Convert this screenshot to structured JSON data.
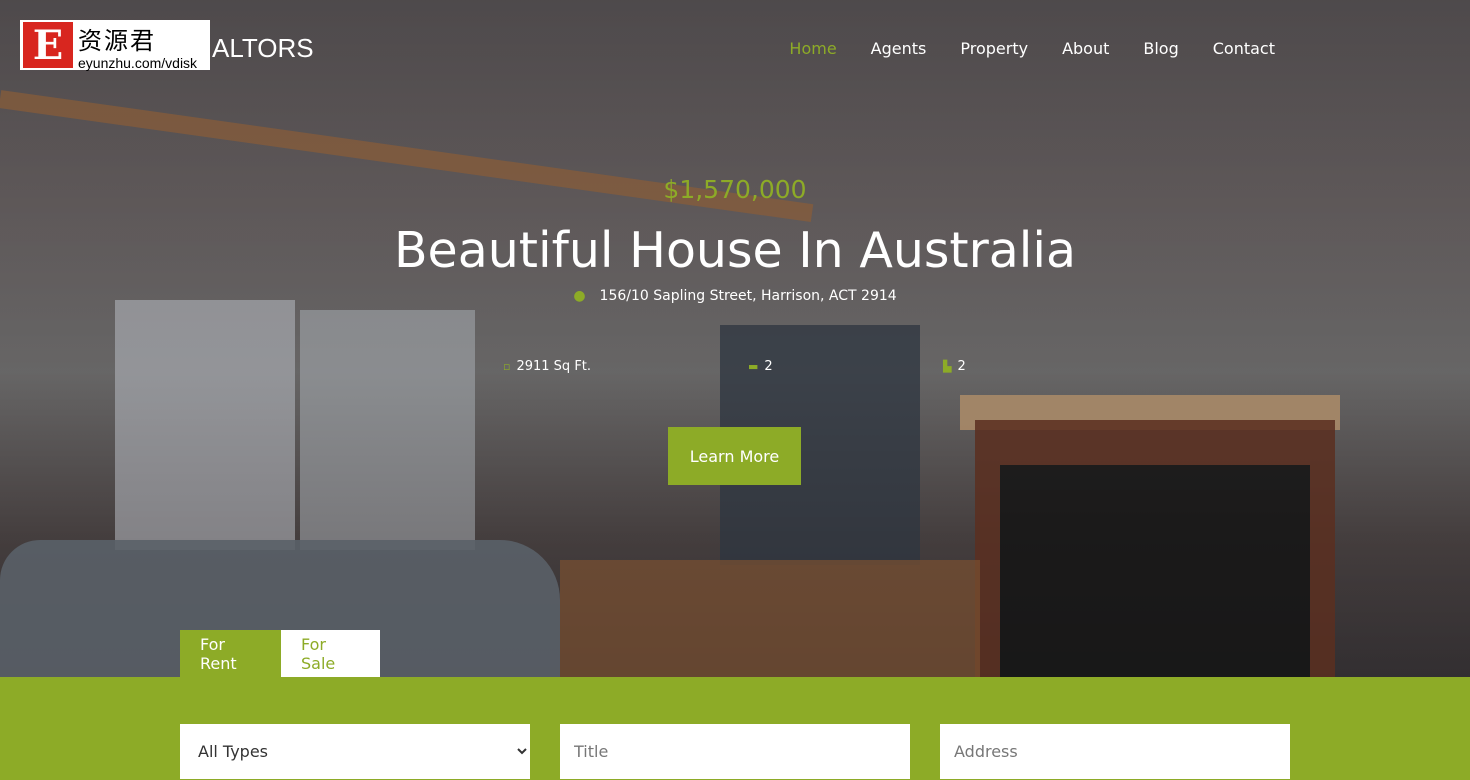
{
  "logo": {
    "letter": "E",
    "chinese": "资源君",
    "url": "eyunzhu.com/vdisk"
  },
  "brand": "ALTORS",
  "nav": [
    {
      "label": "Home",
      "active": true
    },
    {
      "label": "Agents"
    },
    {
      "label": "Property"
    },
    {
      "label": "About"
    },
    {
      "label": "Blog"
    },
    {
      "label": "Contact"
    }
  ],
  "hero": {
    "price": "$1,570,000",
    "title": "Beautiful House In Australia",
    "address": "156/10 Sapling Street, Harrison, ACT 2914",
    "features": {
      "area": "2911 Sq Ft.",
      "beds": "2",
      "baths": "2"
    },
    "cta": "Learn More"
  },
  "tabs": {
    "rent": "For Rent",
    "sale": "For Sale"
  },
  "search": {
    "type_selected": "All Types",
    "title_placeholder": "Title",
    "address_placeholder": "Address"
  },
  "colors": {
    "accent": "#8dab27"
  }
}
